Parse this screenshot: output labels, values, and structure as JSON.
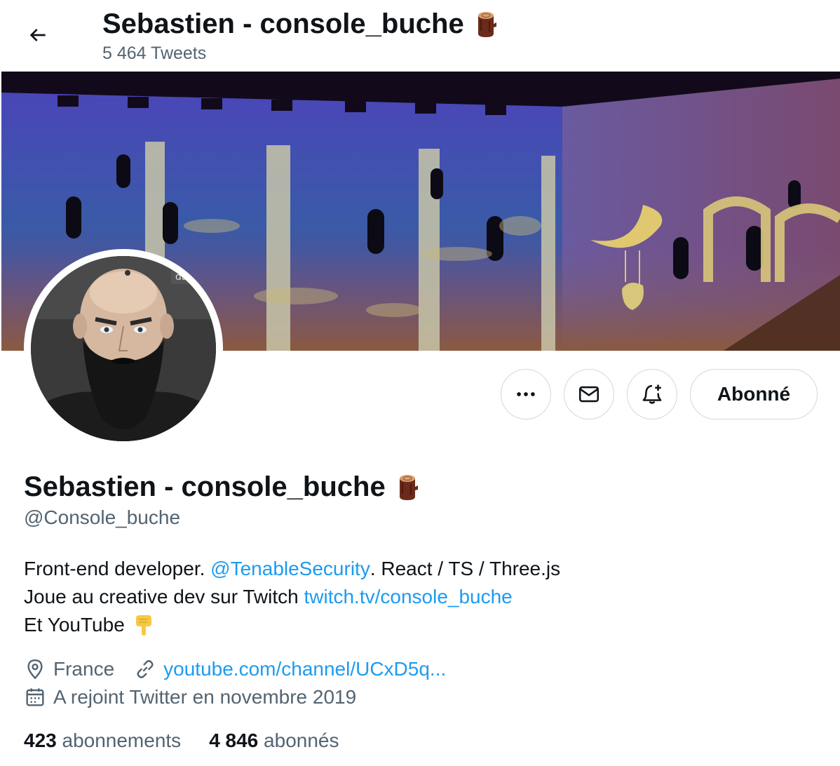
{
  "header": {
    "title": "Sebastien - console_buche",
    "tweet_count": "5 464 Tweets",
    "back_icon": "arrow-left-icon"
  },
  "profile": {
    "name": "Sebastien - console_buche",
    "name_emoji": "log-emoji",
    "handle": "@Console_buche",
    "follow_button": "Abonné",
    "bio": {
      "line1_text": "Front-end developer. ",
      "line1_mention": "@TenableSecurity",
      "line1_rest": ". React / TS / Three.js",
      "line2_text": "Joue au creative dev sur Twitch ",
      "line2_link": "twitch.tv/console_buche",
      "line3_text": "Et YouTube"
    },
    "location": "France",
    "website": "youtube.com/channel/UCxD5q...",
    "joined": "A rejoint Twitter en novembre 2019",
    "following_count": "423",
    "following_label": "abonnements",
    "followers_count": "4 846",
    "followers_label": "abonnés"
  },
  "colors": {
    "link": "#1d9bf0",
    "secondary_text": "#536471",
    "border": "#cfd9de"
  }
}
